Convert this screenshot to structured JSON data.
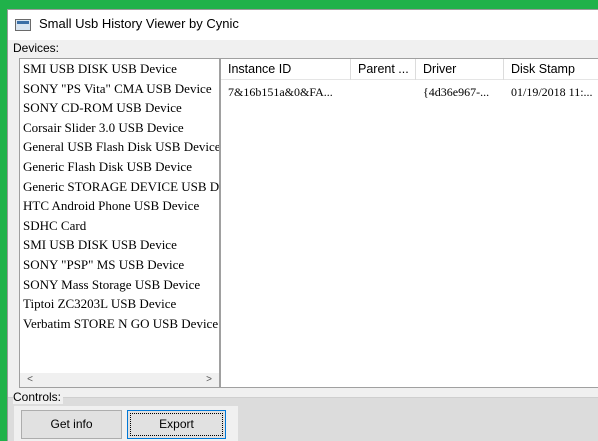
{
  "window": {
    "title": "Small Usb History Viewer by Cynic"
  },
  "devices_group": {
    "label": "Devices:",
    "items": [
      "SMI USB DISK USB Device",
      "SONY \"PS Vita\" CMA USB Device",
      "SONY CD-ROM USB Device",
      "Corsair Slider 3.0 USB Device",
      "General USB Flash Disk USB Device",
      "Generic Flash Disk USB Device",
      "Generic STORAGE DEVICE USB Device",
      "HTC Android Phone USB Device",
      "SDHC Card",
      "SMI USB DISK USB Device",
      "SONY \"PSP\" MS USB Device",
      "SONY Mass Storage USB Device",
      "Tiptoi ZC3203L USB Device",
      "Verbatim STORE N GO USB Device"
    ],
    "scroll_left_glyph": "<",
    "scroll_right_glyph": ">"
  },
  "details_table": {
    "columns": [
      "Instance ID",
      "Parent ...",
      "Driver",
      "Disk Stamp"
    ],
    "rows": [
      [
        "7&16b151a&0&FA...",
        "",
        "{4d36e967-...",
        "01/19/2018 11:..."
      ]
    ]
  },
  "controls_group": {
    "label": "Controls:",
    "get_info_label": "Get info",
    "export_label": "Export"
  }
}
